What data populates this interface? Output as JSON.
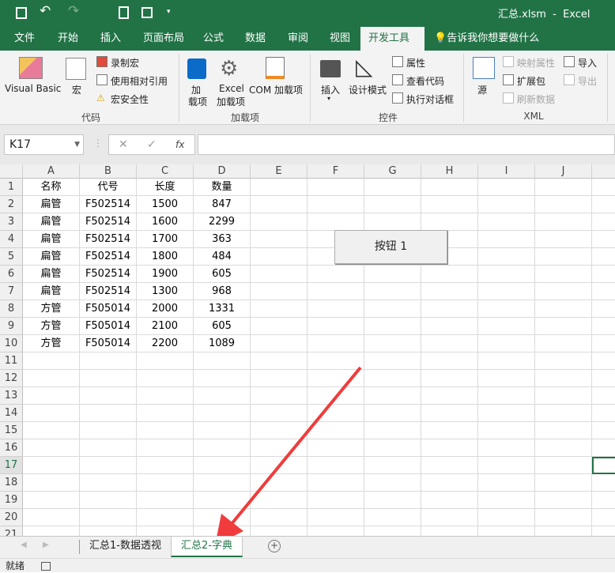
{
  "title": "汇总.xlsm  -  Excel",
  "tabs": [
    "文件",
    "开始",
    "插入",
    "页面布局",
    "公式",
    "数据",
    "审阅",
    "视图",
    "开发工具"
  ],
  "tell_me": "告诉我你想要做什么",
  "ribbon": {
    "code": {
      "label": "代码",
      "vb": "Visual Basic",
      "macro": "宏",
      "record": "录制宏",
      "relative": "使用相对引用",
      "security": "宏安全性"
    },
    "addins": {
      "label": "加载项",
      "addins1": "加",
      "addins2": "载项",
      "excel1": "Excel",
      "excel2": "加载项",
      "com": "COM 加载项"
    },
    "controls": {
      "label": "控件",
      "insert": "插入",
      "design": "设计模式",
      "props": "属性",
      "view_code": "查看代码",
      "dialog": "执行对话框"
    },
    "xml": {
      "label": "XML",
      "source": "源",
      "map_props": "映射属性",
      "expansion": "扩展包",
      "refresh": "刷新数据",
      "import": "导入",
      "export": "导出"
    }
  },
  "name_box": "K17",
  "fx": "fx",
  "columns": [
    "A",
    "B",
    "C",
    "D",
    "E",
    "F",
    "G",
    "H",
    "I",
    "J"
  ],
  "rows": [
    [
      "名称",
      "代号",
      "长度",
      "数量"
    ],
    [
      "扁管",
      "F502514",
      "1500",
      "847"
    ],
    [
      "扁管",
      "F502514",
      "1600",
      "2299"
    ],
    [
      "扁管",
      "F502514",
      "1700",
      "363"
    ],
    [
      "扁管",
      "F502514",
      "1800",
      "484"
    ],
    [
      "扁管",
      "F502514",
      "1900",
      "605"
    ],
    [
      "扁管",
      "F502514",
      "1300",
      "968"
    ],
    [
      "方管",
      "F505014",
      "2000",
      "1331"
    ],
    [
      "方管",
      "F505014",
      "2100",
      "605"
    ],
    [
      "方管",
      "F505014",
      "2200",
      "1089"
    ]
  ],
  "row_count": 21,
  "form_button": "按钮 1",
  "sheets": [
    "汇总1-数据透视",
    "汇总2-字典"
  ],
  "status": "就绪",
  "accent": "#217346"
}
